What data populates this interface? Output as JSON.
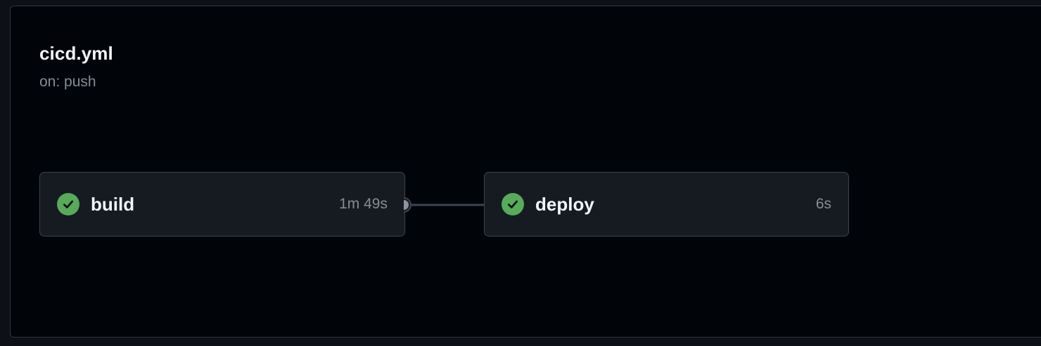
{
  "workflow": {
    "title": "cicd.yml",
    "trigger": "on: push"
  },
  "jobs": [
    {
      "name": "build",
      "duration": "1m 49s",
      "status": "success",
      "icon": "check-circle-icon"
    },
    {
      "name": "deploy",
      "duration": "6s",
      "status": "success",
      "icon": "check-circle-icon"
    }
  ],
  "colors": {
    "background": "#010409",
    "card": "#161b22",
    "border": "#3d444d",
    "success": "#57ab5a",
    "text": "#f0f6fc",
    "muted": "#848d97"
  }
}
